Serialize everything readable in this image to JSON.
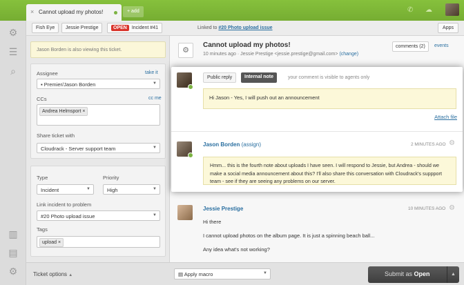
{
  "topbar": {
    "tab_title": "Cannot upload my photos!",
    "add_tab": "+ add"
  },
  "subbar": {
    "requester_org": "Fish Eye",
    "requester": "Jessie Prestige",
    "status": "OPEN",
    "incident": "Incident #41",
    "linked_prefix": "Linked to",
    "linked_link": "#20 Photo upload issue",
    "apps": "Apps"
  },
  "sidebar": {
    "notice": "Jason Borden is also viewing this ticket.",
    "assignee_label": "Assignee",
    "take_it": "take it",
    "assignee_value": "Premier/Jason Borden",
    "ccs_label": "CCs",
    "cc_me": "cc me",
    "cc_tag": "Andrea Helmsport",
    "share_label": "Share ticket with",
    "share_value": "Cloudrack - Server support team",
    "type_label": "Type",
    "type_value": "Incident",
    "priority_label": "Priority",
    "priority_value": "High",
    "link_label": "Link incident to problem",
    "link_value": "#20 Photo upload issue",
    "tags_label": "Tags",
    "tag_value": "upload"
  },
  "main": {
    "subject": "Cannot upload my photos!",
    "time_ago": "10 minutes ago",
    "sep": "·",
    "requester": "Jessie Prestige",
    "email": "<jessie.prestige@gmail.com>",
    "change": "(change)",
    "comments": "comments (2)",
    "events": "events"
  },
  "composer": {
    "public_reply": "Public reply",
    "internal_note": "Internal note",
    "visibility": "your comment is visible to agents only",
    "text": "Hi Jason - Yes, I will push out an announcement",
    "attach": "Attach file"
  },
  "comment1": {
    "author": "Jason Borden",
    "assign": "(assign)",
    "time": "2 MINUTES AGO",
    "text": "Hmm... this is the fourth note about uploads I have seen. I will respond to Jessie, but Andrea - should we make a social media announcement about this?  I'll also share this conversation with Cloudrack's suppport team - see if they are seeing any problems on our server."
  },
  "comment2": {
    "author": "Jessie Prestige",
    "time": "10 MINUTES AGO",
    "line1": "Hi there",
    "line2": "I cannot upload photos on the album page. It is just a spinning beach ball...",
    "line3": "Any idea what's not working?"
  },
  "bottombar": {
    "ticket_options": "Ticket options",
    "apply_macro": "Apply macro",
    "submit_prefix": "Submit as",
    "submit_status": "Open"
  },
  "icons": {
    "nav": [
      "gear-icon",
      "list-icon",
      "search-icon",
      "chart-icon",
      "report-icon",
      "settings-icon"
    ]
  }
}
